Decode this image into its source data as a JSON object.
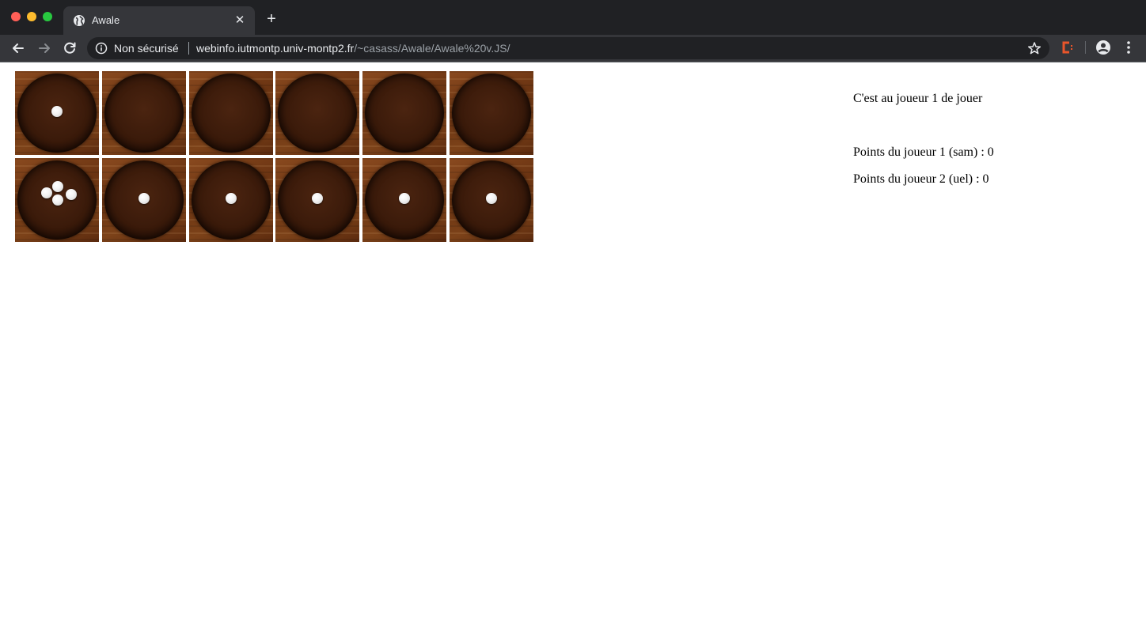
{
  "browser": {
    "tab_title": "Awale",
    "tab_close_glyph": "✕",
    "new_tab_glyph": "+",
    "security_label": "Non sécurisé",
    "url_host": "webinfo.iutmontp.univ-montp2.fr",
    "url_path": "/~casass/Awale/Awale%20v.JS/",
    "icons": [
      "close-window-icon",
      "minimize-window-icon",
      "maximize-window-icon",
      "globe-icon",
      "back-arrow-icon",
      "forward-arrow-icon",
      "reload-icon",
      "info-icon",
      "star-icon",
      "extension-icon",
      "profile-icon",
      "kebab-menu-icon"
    ]
  },
  "game": {
    "board": {
      "top_row_seeds": [
        1,
        0,
        0,
        0,
        0,
        0
      ],
      "bottom_row_seeds": [
        4,
        1,
        1,
        1,
        1,
        1
      ]
    },
    "turn_text": "C'est au joueur 1 de jouer",
    "score_player1": "Points du joueur 1 (sam) : 0",
    "score_player2": "Points du joueur 2 (uel) : 0"
  },
  "colors": {
    "tabstrip_bg": "#202124",
    "toolbar_bg": "#35363a",
    "omnibox_bg": "#202124",
    "chrome_text": "#e8eaed",
    "url_path": "#9aa0a6",
    "extension_accent": "#e8552b",
    "page_bg": "#ffffff",
    "seed": "#f2f2f2",
    "wood": "#6b3412"
  }
}
